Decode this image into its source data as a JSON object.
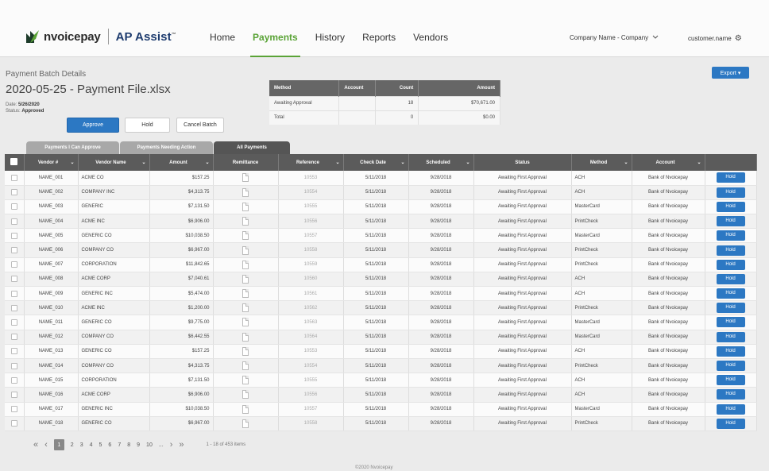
{
  "brand": {
    "logo_text": "nvoicepay",
    "product": "AP Assist",
    "tm": "™",
    "green": "#5aa336",
    "blue": "#2c78c3"
  },
  "nav": {
    "items": [
      {
        "label": "Home",
        "active": false
      },
      {
        "label": "Payments",
        "active": true
      },
      {
        "label": "History",
        "active": false
      },
      {
        "label": "Reports",
        "active": false
      },
      {
        "label": "Vendors",
        "active": false
      }
    ]
  },
  "header": {
    "company": "Company Name - Company",
    "company_icon": "chevron-down-icon",
    "user": "customer.name",
    "user_icon": "gear-icon"
  },
  "batch": {
    "section_label": "Payment Batch Details",
    "title": "2020-05-25 - Payment File.xlsx",
    "date_label": "Date:",
    "date_value": "5/26/2020",
    "status_label": "Status:",
    "status_value": "Approved",
    "approve": "Approve",
    "hold": "Hold",
    "cancel": "Cancel Batch",
    "export": "Export ▾"
  },
  "summary": {
    "headers": [
      "Method",
      "Account",
      "Count",
      "Amount"
    ],
    "rows": [
      [
        "Awaiting Approval",
        "",
        "18",
        "$70,671.00"
      ],
      [
        "Total",
        "",
        "0",
        "$0.00"
      ]
    ]
  },
  "tabs": [
    {
      "label": "Payments I Can Approve",
      "active": false
    },
    {
      "label": "Payments Needing Action",
      "active": false
    },
    {
      "label": "All Payments",
      "active": true
    }
  ],
  "table": {
    "headers": [
      "Vendor #",
      "Vendor Name",
      "Amount",
      "Remittance",
      "Reference",
      "Check Date",
      "Scheduled",
      "Status",
      "Method",
      "Account"
    ],
    "hold_label": "Hold",
    "rows": [
      [
        "NAME_001",
        "ACME CO",
        "$157.25",
        "10553",
        "5/11/2018",
        "9/28/2018",
        "Awaiting First Approval",
        "ACH",
        "Bank of Nvoicepay"
      ],
      [
        "NAME_002",
        "COMPANY INC",
        "$4,313.75",
        "10554",
        "5/11/2018",
        "9/28/2018",
        "Awaiting First Approval",
        "ACH",
        "Bank of Nvoicepay"
      ],
      [
        "NAME_003",
        "GENERIC",
        "$7,131.50",
        "10555",
        "5/11/2018",
        "9/28/2018",
        "Awaiting First Approval",
        "MasterCard",
        "Bank of Nvoicepay"
      ],
      [
        "NAME_004",
        "ACME INC",
        "$6,906.00",
        "10556",
        "5/11/2018",
        "9/28/2018",
        "Awaiting First Approval",
        "PrintCheck",
        "Bank of Nvoicepay"
      ],
      [
        "NAME_005",
        "GENERIC CO",
        "$10,038.50",
        "10557",
        "5/11/2018",
        "9/28/2018",
        "Awaiting First Approval",
        "MasterCard",
        "Bank of Nvoicepay"
      ],
      [
        "NAME_006",
        "COMPANY CO",
        "$6,967.00",
        "10558",
        "5/11/2018",
        "9/28/2018",
        "Awaiting First Approval",
        "PrintCheck",
        "Bank of Nvoicepay"
      ],
      [
        "NAME_007",
        "CORPORATION",
        "$11,842.65",
        "10559",
        "5/11/2018",
        "9/28/2018",
        "Awaiting First Approval",
        "PrintCheck",
        "Bank of Nvoicepay"
      ],
      [
        "NAME_008",
        "ACME CORP",
        "$7,040.61",
        "10560",
        "5/11/2018",
        "9/28/2018",
        "Awaiting First Approval",
        "ACH",
        "Bank of Nvoicepay"
      ],
      [
        "NAME_009",
        "GENERIC INC",
        "$5,474.00",
        "10561",
        "5/11/2018",
        "9/28/2018",
        "Awaiting First Approval",
        "ACH",
        "Bank of Nvoicepay"
      ],
      [
        "NAME_010",
        "ACME INC",
        "$1,200.00",
        "10562",
        "5/11/2018",
        "9/28/2018",
        "Awaiting First Approval",
        "PrintCheck",
        "Bank of Nvoicepay"
      ],
      [
        "NAME_011",
        "GENERIC CO",
        "$9,775.00",
        "10563",
        "5/11/2018",
        "9/28/2018",
        "Awaiting First Approval",
        "MasterCard",
        "Bank of Nvoicepay"
      ],
      [
        "NAME_012",
        "COMPANY CO",
        "$6,442.55",
        "10564",
        "5/11/2018",
        "9/28/2018",
        "Awaiting First Approval",
        "MasterCard",
        "Bank of Nvoicepay"
      ],
      [
        "NAME_013",
        "GENERIC CO",
        "$157.25",
        "10553",
        "5/11/2018",
        "9/28/2018",
        "Awaiting First Approval",
        "ACH",
        "Bank of Nvoicepay"
      ],
      [
        "NAME_014",
        "COMPANY CO",
        "$4,313.75",
        "10554",
        "5/11/2018",
        "9/28/2018",
        "Awaiting First Approval",
        "PrintCheck",
        "Bank of Nvoicepay"
      ],
      [
        "NAME_015",
        "CORPORATION",
        "$7,131.50",
        "10555",
        "5/11/2018",
        "9/28/2018",
        "Awaiting First Approval",
        "ACH",
        "Bank of Nvoicepay"
      ],
      [
        "NAME_016",
        "ACME CORP",
        "$6,906.00",
        "10556",
        "5/11/2018",
        "9/28/2018",
        "Awaiting First Approval",
        "ACH",
        "Bank of Nvoicepay"
      ],
      [
        "NAME_017",
        "GENERIC INC",
        "$10,038.50",
        "10557",
        "5/11/2018",
        "9/28/2018",
        "Awaiting First Approval",
        "MasterCard",
        "Bank of Nvoicepay"
      ],
      [
        "NAME_018",
        "GENERIC CO",
        "$6,967.00",
        "10558",
        "5/11/2018",
        "9/28/2018",
        "Awaiting First Approval",
        "PrintCheck",
        "Bank of Nvoicepay"
      ]
    ]
  },
  "pager": {
    "first": "«",
    "prev": "‹",
    "next": "›",
    "last": "»",
    "pages": [
      "1",
      "2",
      "3",
      "4",
      "5",
      "6",
      "7",
      "8",
      "9",
      "10",
      "..."
    ],
    "active_page": "1",
    "info": "1 - 18 of 453 items"
  },
  "footer": "©2020 Nvoicepay"
}
